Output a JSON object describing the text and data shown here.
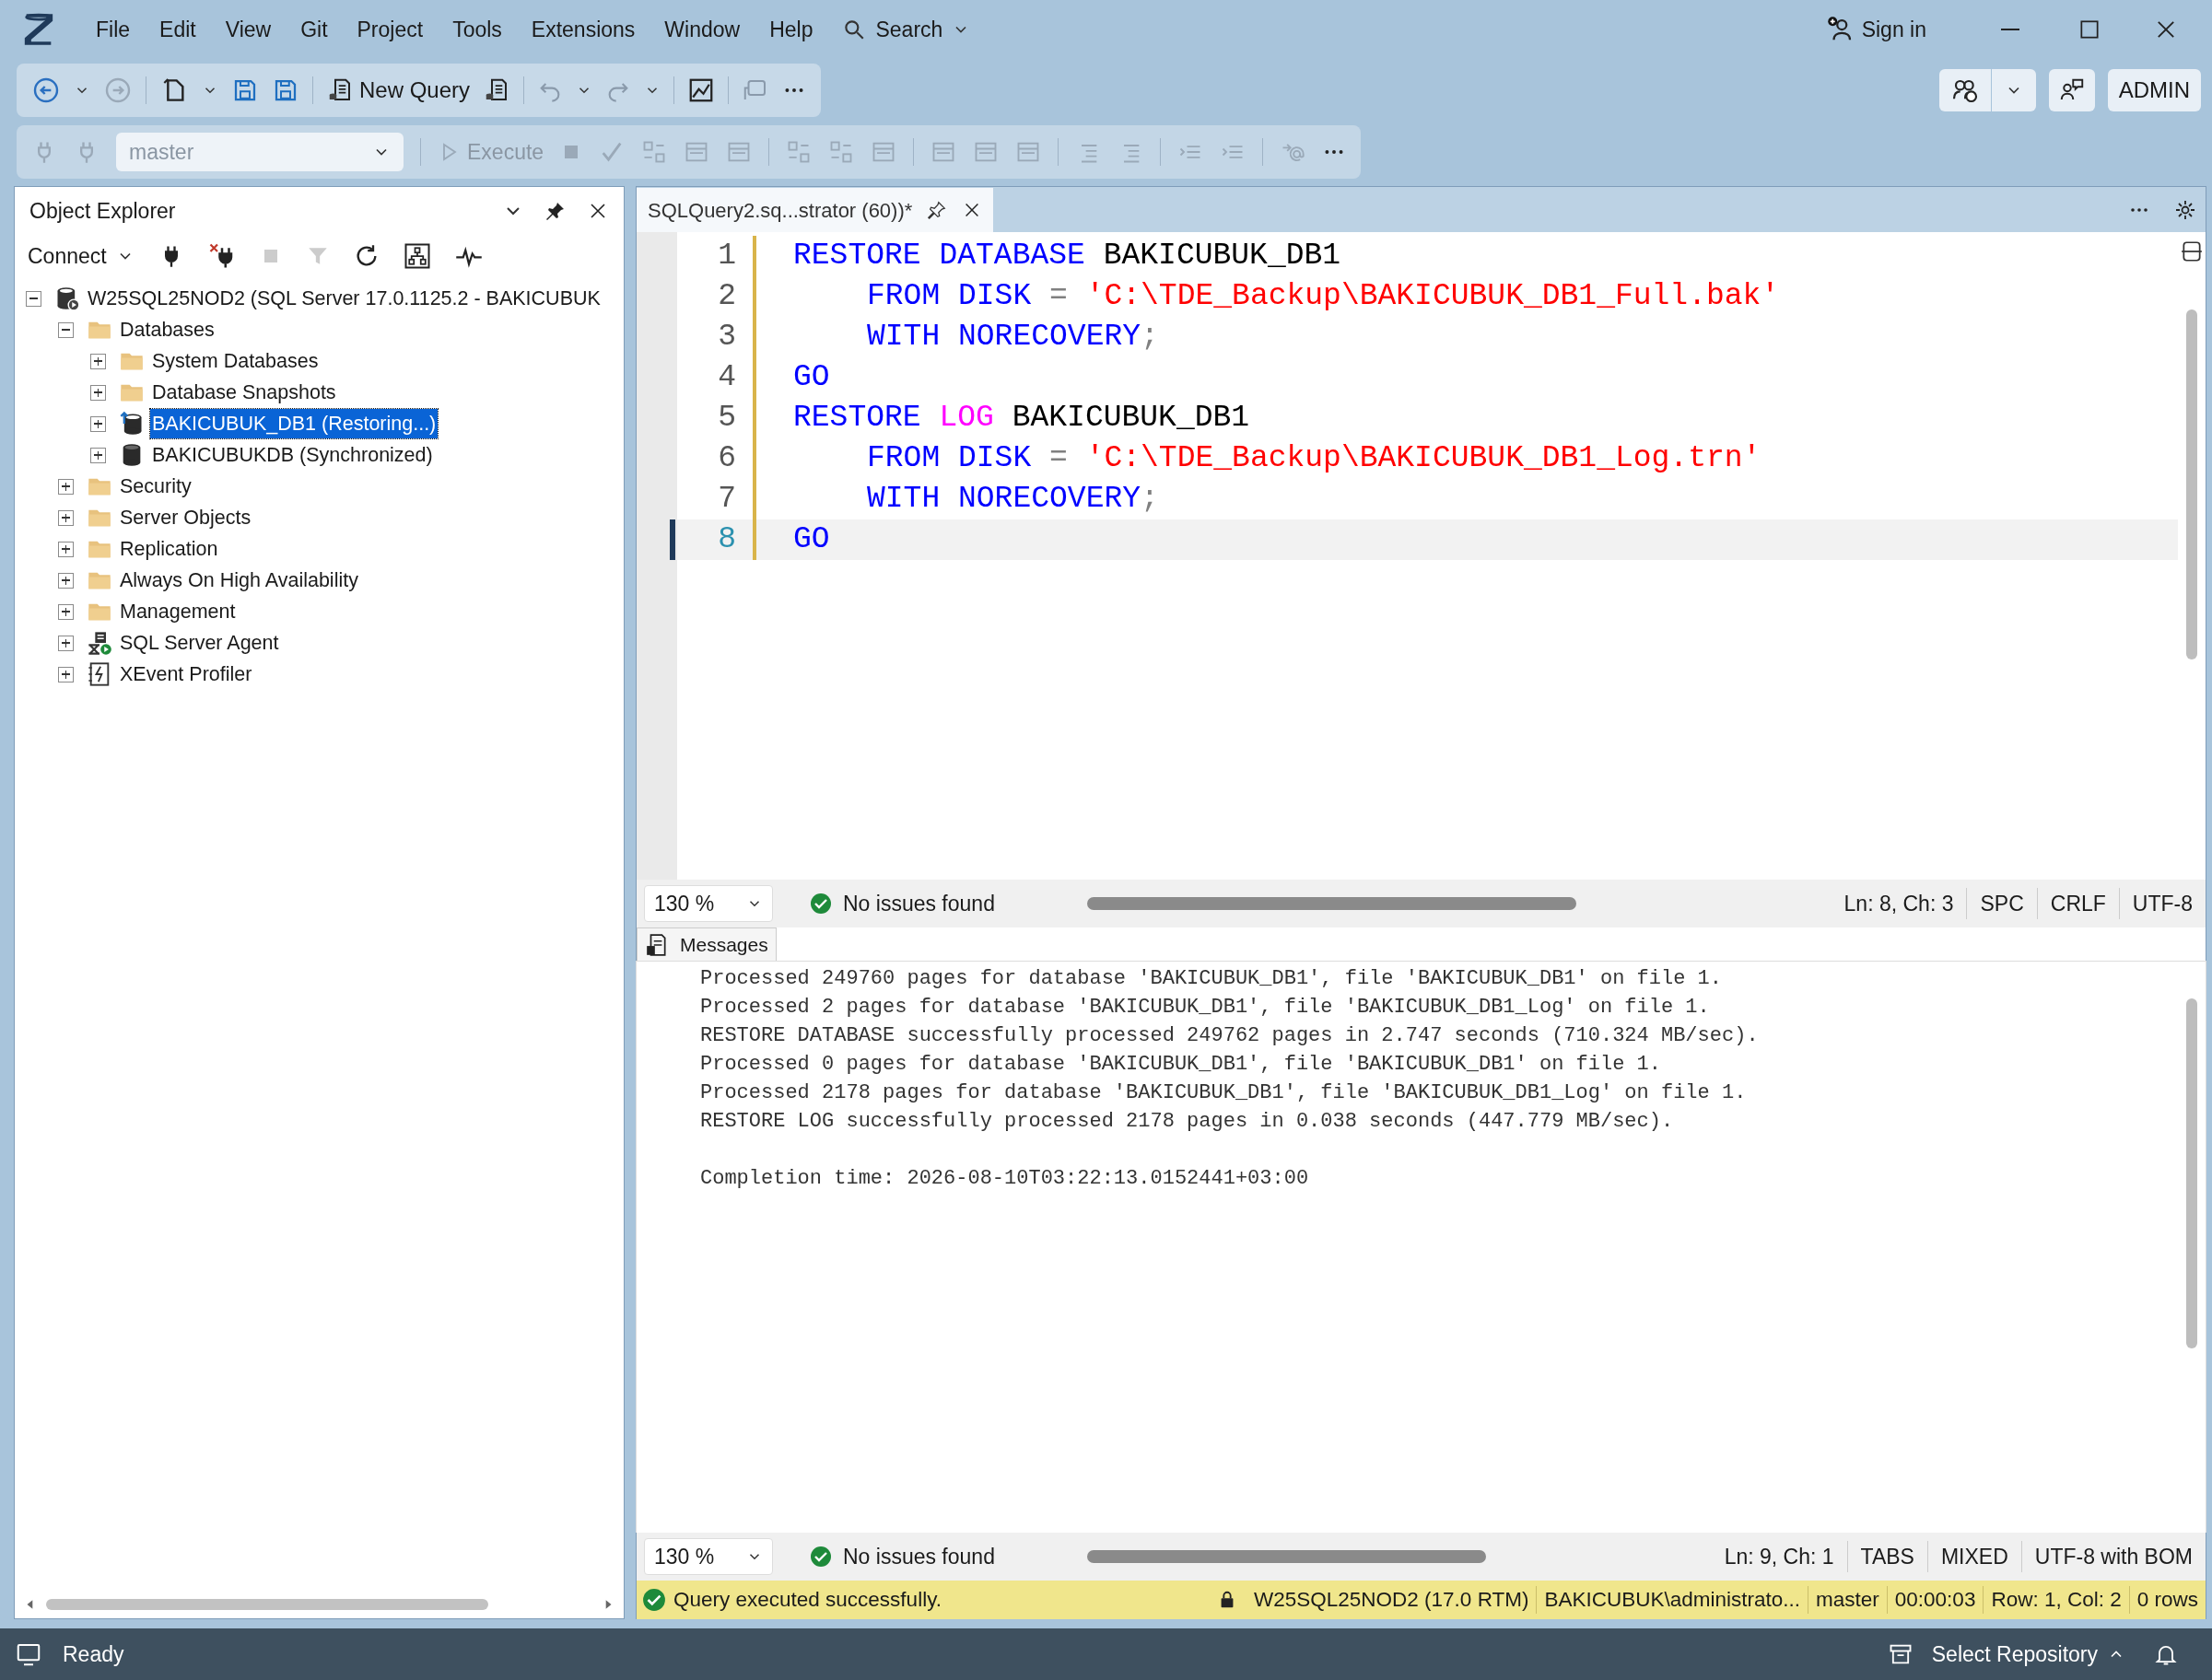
{
  "menu": {
    "items": [
      "File",
      "Edit",
      "View",
      "Git",
      "Project",
      "Tools",
      "Extensions",
      "Window",
      "Help"
    ],
    "search": "Search",
    "sign_in": "Sign in"
  },
  "toolbar": {
    "new_query": "New Query",
    "database": "master",
    "execute": "Execute",
    "account": "ADMIN"
  },
  "object_explorer": {
    "title": "Object Explorer",
    "connect": "Connect",
    "tree": [
      {
        "label": "W25SQL25NOD2 (SQL Server 17.0.1125.2 - BAKICUBUK",
        "kind": "server",
        "expanded": true,
        "selected": false,
        "children": [
          {
            "label": "Databases",
            "kind": "folder",
            "expanded": true,
            "selected": false,
            "children": [
              {
                "label": "System Databases",
                "kind": "folder",
                "expanded": false,
                "selected": false
              },
              {
                "label": "Database Snapshots",
                "kind": "folder",
                "expanded": false,
                "selected": false
              },
              {
                "label": "BAKICUBUK_DB1 (Restoring...)",
                "kind": "restoring_database",
                "expanded": false,
                "selected": true
              },
              {
                "label": "BAKICUBUKDB (Synchronized)",
                "kind": "database",
                "expanded": false,
                "selected": false
              }
            ]
          },
          {
            "label": "Security",
            "kind": "folder",
            "expanded": false,
            "selected": false
          },
          {
            "label": "Server Objects",
            "kind": "folder",
            "expanded": false,
            "selected": false
          },
          {
            "label": "Replication",
            "kind": "folder",
            "expanded": false,
            "selected": false
          },
          {
            "label": "Always On High Availability",
            "kind": "folder",
            "expanded": false,
            "selected": false
          },
          {
            "label": "Management",
            "kind": "folder",
            "expanded": false,
            "selected": false
          },
          {
            "label": "SQL Server Agent",
            "kind": "agent",
            "expanded": false,
            "selected": false
          },
          {
            "label": "XEvent Profiler",
            "kind": "profiler",
            "expanded": false,
            "selected": false
          }
        ]
      }
    ]
  },
  "editor": {
    "tab": "SQLQuery2.sq...strator (60))*",
    "lines": [
      {
        "number": "1",
        "indented": false,
        "current": false,
        "tokens": [
          {
            "kind": "keyword",
            "text": "RESTORE DATABASE"
          },
          {
            "kind": "plain",
            "text": " BAKICUBUK_DB1"
          }
        ]
      },
      {
        "number": "2",
        "indented": true,
        "current": false,
        "tokens": [
          {
            "kind": "keyword",
            "text": "FROM DISK"
          },
          {
            "kind": "punct",
            "text": " = "
          },
          {
            "kind": "string",
            "text": "'C:\\TDE_Backup\\BAKICUBUK_DB1_Full.bak'"
          }
        ]
      },
      {
        "number": "3",
        "indented": true,
        "current": false,
        "tokens": [
          {
            "kind": "keyword",
            "text": "WITH NORECOVERY"
          },
          {
            "kind": "punct",
            "text": ";"
          }
        ]
      },
      {
        "number": "4",
        "indented": false,
        "current": false,
        "tokens": [
          {
            "kind": "keyword",
            "text": "GO"
          }
        ]
      },
      {
        "number": "5",
        "indented": false,
        "current": false,
        "tokens": [
          {
            "kind": "keyword",
            "text": "RESTORE "
          },
          {
            "kind": "function",
            "text": "LOG"
          },
          {
            "kind": "plain",
            "text": " BAKICUBUK_DB1"
          }
        ]
      },
      {
        "number": "6",
        "indented": true,
        "current": false,
        "tokens": [
          {
            "kind": "keyword",
            "text": "FROM DISK"
          },
          {
            "kind": "punct",
            "text": " = "
          },
          {
            "kind": "string",
            "text": "'C:\\TDE_Backup\\BAKICUBUK_DB1_Log.trn'"
          }
        ]
      },
      {
        "number": "7",
        "indented": true,
        "current": false,
        "tokens": [
          {
            "kind": "keyword",
            "text": "WITH NORECOVERY"
          },
          {
            "kind": "punct",
            "text": ";"
          }
        ]
      },
      {
        "number": "8",
        "indented": false,
        "current": true,
        "tokens": [
          {
            "kind": "keyword",
            "text": "GO"
          }
        ]
      }
    ],
    "status": {
      "zoom": "130 %",
      "issues": "No issues found",
      "fields": [
        "Ln: 8, Ch: 3",
        "SPC",
        "CRLF",
        "UTF-8"
      ]
    }
  },
  "messages": {
    "tab": "Messages",
    "lines": [
      "Processed 249760 pages for database 'BAKICUBUK_DB1', file 'BAKICUBUK_DB1' on file 1.",
      "Processed 2 pages for database 'BAKICUBUK_DB1', file 'BAKICUBUK_DB1_Log' on file 1.",
      "RESTORE DATABASE successfully processed 249762 pages in 2.747 seconds (710.324 MB/sec).",
      "Processed 0 pages for database 'BAKICUBUK_DB1', file 'BAKICUBUK_DB1' on file 1.",
      "Processed 2178 pages for database 'BAKICUBUK_DB1', file 'BAKICUBUK_DB1_Log' on file 1.",
      "RESTORE LOG successfully processed 2178 pages in 0.038 seconds (447.779 MB/sec)."
    ],
    "completion": "Completion time: 2026-08-10T03:22:13.0152441+03:00",
    "status": {
      "zoom": "130 %",
      "issues": "No issues found",
      "fields": [
        "Ln: 9, Ch: 1",
        "TABS",
        "MIXED",
        "UTF-8 with BOM"
      ]
    }
  },
  "query_status": {
    "message": "Query executed successfully.",
    "server": "W25SQL25NOD2 (17.0 RTM)",
    "fields": [
      "BAKICUBUK\\administrato...",
      "master",
      "00:00:03",
      "Row: 1, Col: 2",
      "0 rows"
    ]
  },
  "status_bar": {
    "state": "Ready",
    "repository": "Select Repository"
  }
}
